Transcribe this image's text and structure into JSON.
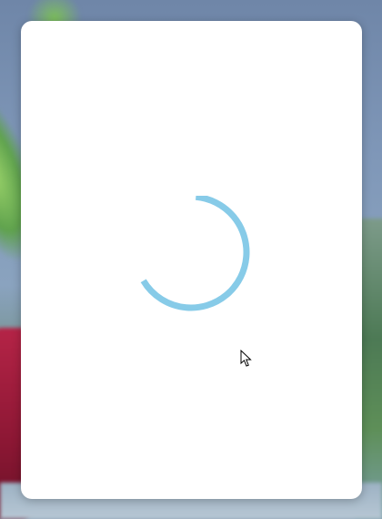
{
  "background": {
    "description_label": ""
  },
  "dialog": {
    "state": "loading"
  },
  "spinner": {
    "icon": "loading-spinner-icon",
    "color": "#87cbe8",
    "progress_fraction": 0.65
  },
  "cursor": {
    "icon": "mouse-pointer-icon"
  }
}
